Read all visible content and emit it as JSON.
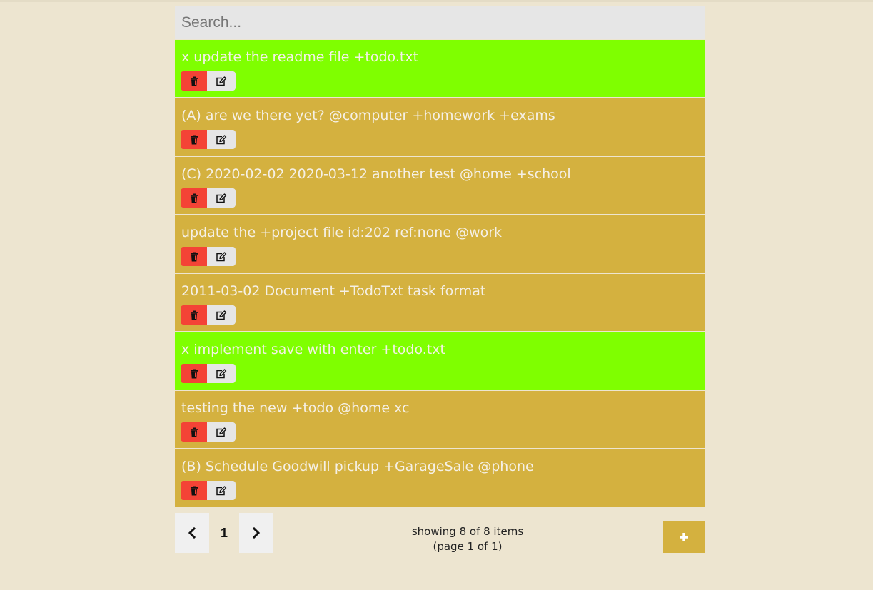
{
  "search": {
    "placeholder": "Search...",
    "value": ""
  },
  "colors": {
    "pending": "#d4b13f",
    "done": "#7fff00",
    "delete": "#f44336",
    "background": "#ede5d0"
  },
  "todos": [
    {
      "text": "x update the readme file +todo.txt",
      "done": true
    },
    {
      "text": "(A) are we there yet? @computer +homework +exams",
      "done": false
    },
    {
      "text": "(C) 2020-02-02 2020-03-12 another test @home +school",
      "done": false
    },
    {
      "text": "update the +project file id:202 ref:none @work",
      "done": false
    },
    {
      "text": "2011-03-02 Document +TodoTxt task format",
      "done": false
    },
    {
      "text": "x implement save with enter +todo.txt",
      "done": true
    },
    {
      "text": "testing the new +todo @home xc",
      "done": false
    },
    {
      "text": "(B) Schedule Goodwill pickup +GarageSale @phone",
      "done": false
    }
  ],
  "item_icons": {
    "delete": "trash-icon",
    "edit": "edit-icon"
  },
  "pagination": {
    "prev_icon": "chevron-left-icon",
    "current_page": "1",
    "next_icon": "chevron-right-icon",
    "showing": "showing 8 of 8 items",
    "page_info": "(page 1 of 1)"
  },
  "add_button": {
    "icon": "plus-icon"
  }
}
